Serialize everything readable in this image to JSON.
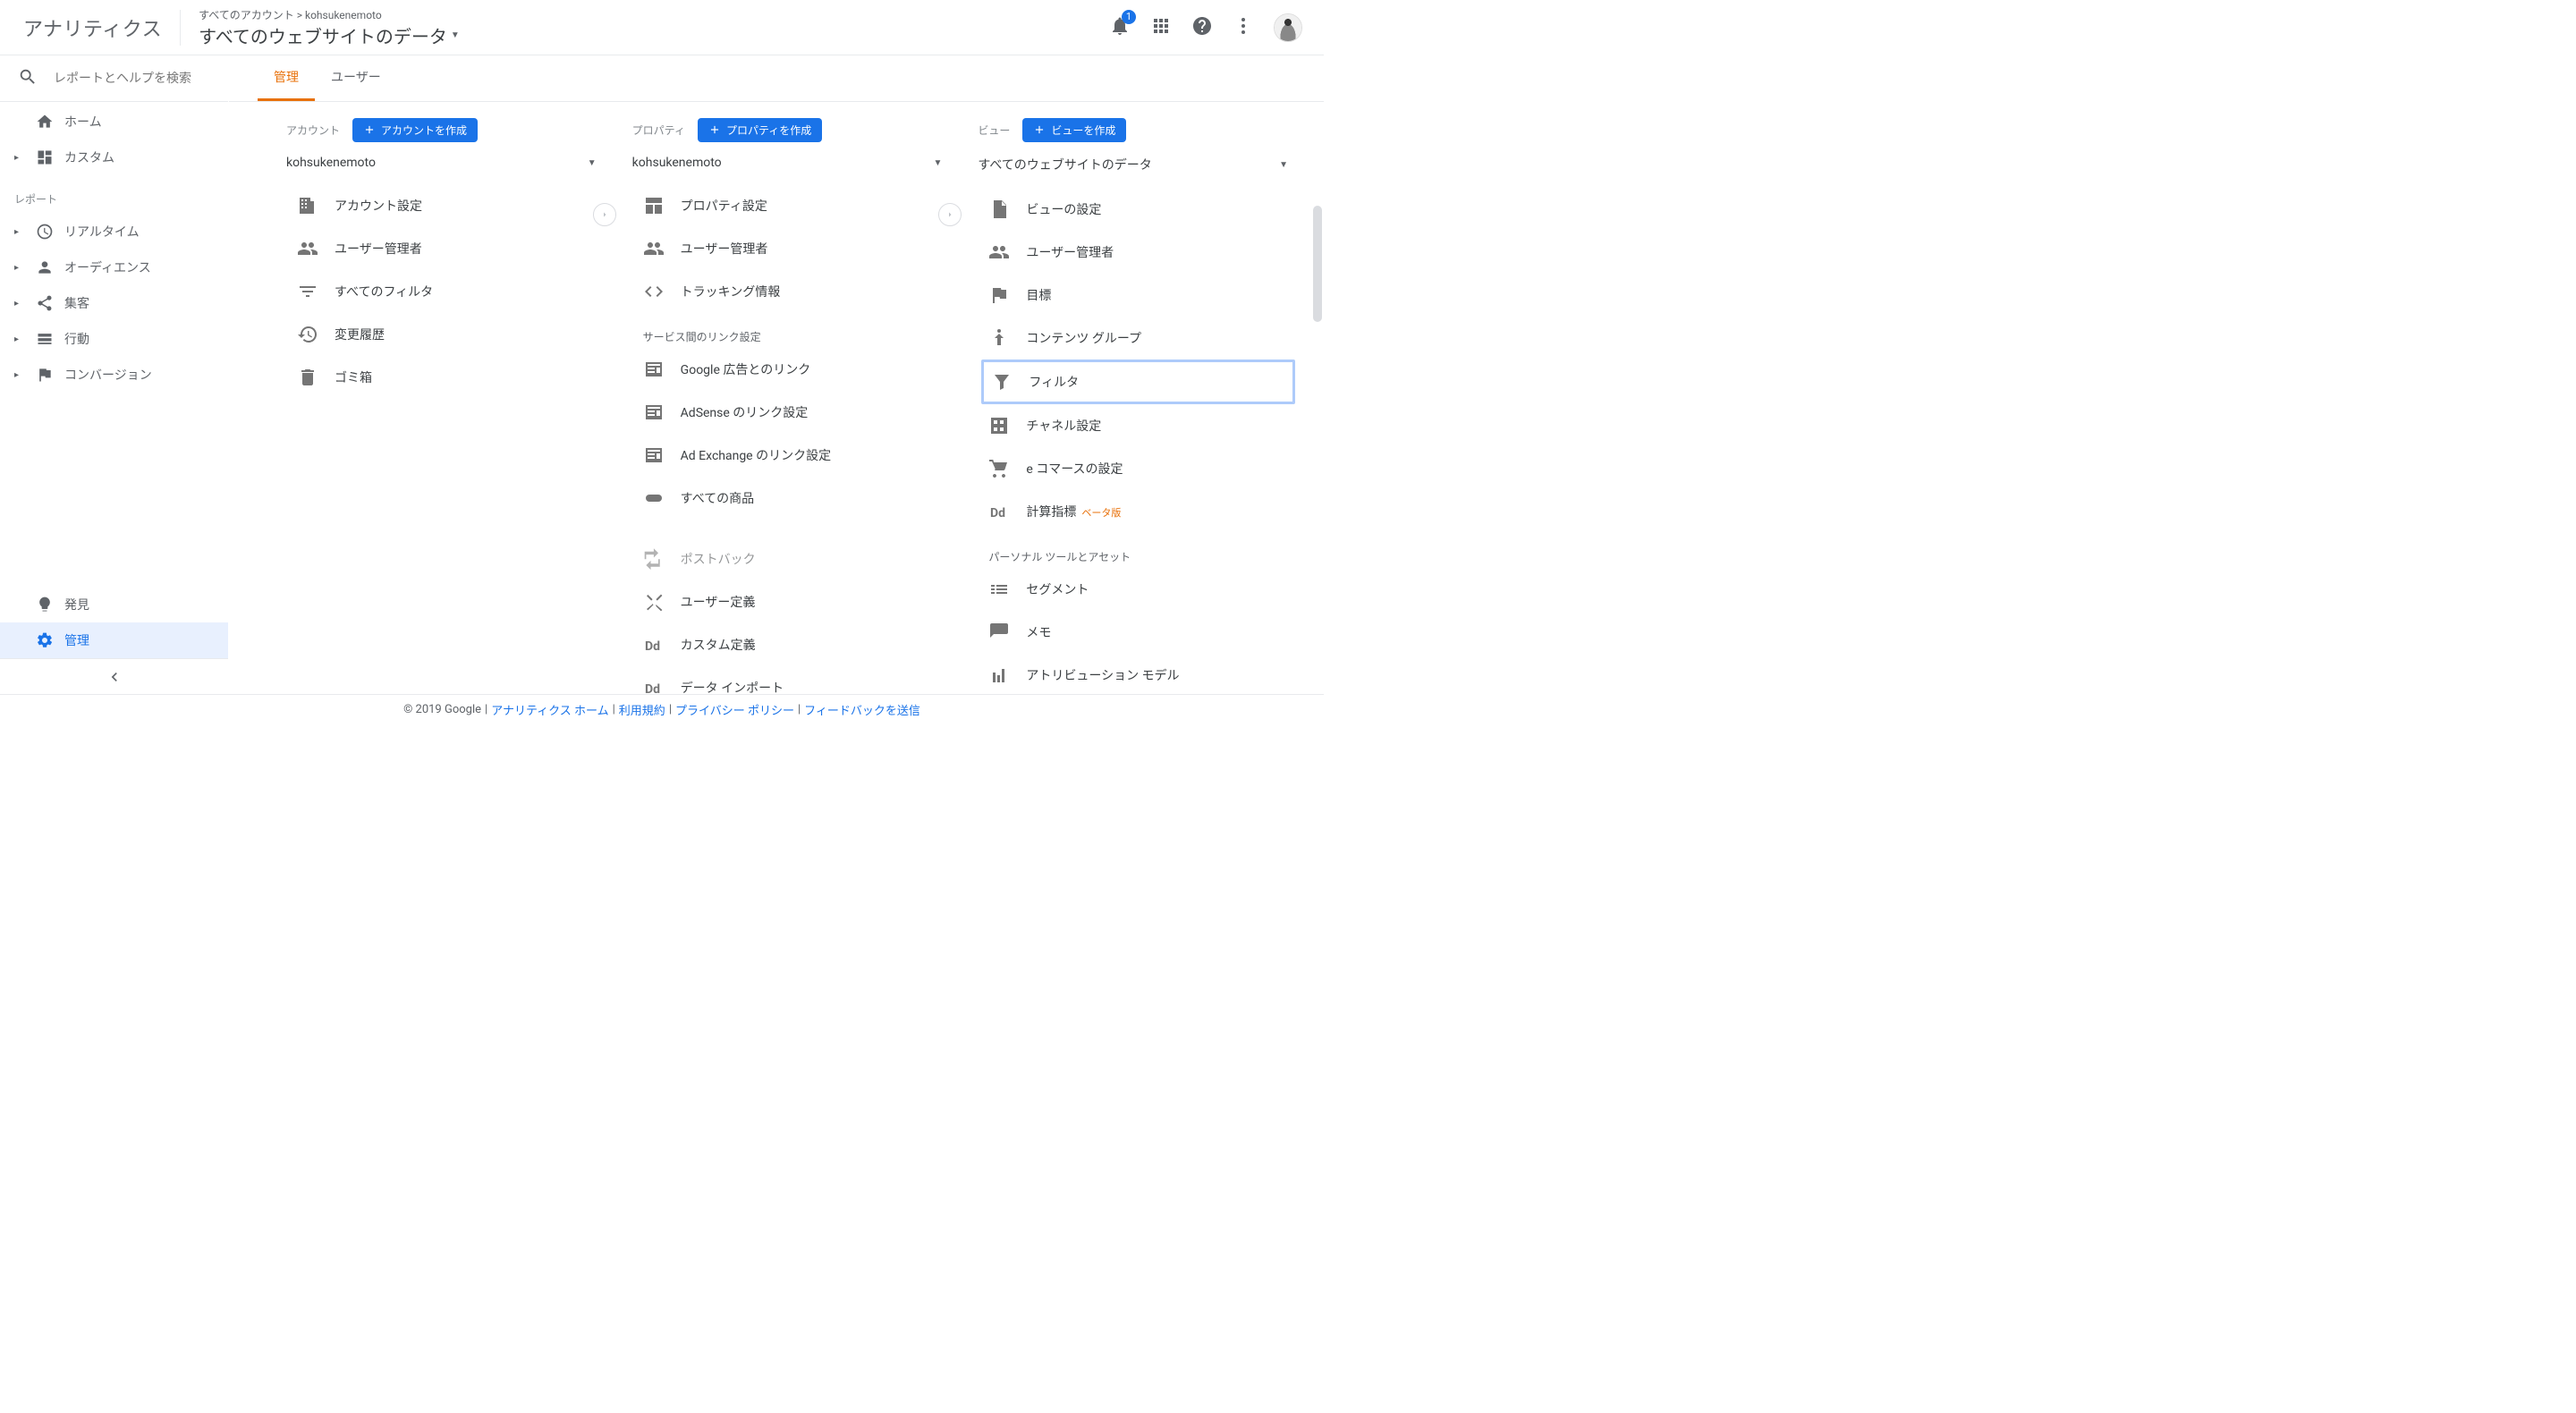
{
  "header": {
    "breadcrumb": "すべてのアカウント > kohsukenemoto",
    "title": "すべてのウェブサイトのデータ",
    "logo_text": "アナリティクス",
    "notification_count": "1"
  },
  "search": {
    "placeholder": "レポートとヘルプを検索"
  },
  "sidebar": {
    "home": "ホーム",
    "custom": "カスタム",
    "reports_label": "レポート",
    "realtime": "リアルタイム",
    "audience": "オーディエンス",
    "acquisition": "集客",
    "behavior": "行動",
    "conversions": "コンバージョン",
    "discover": "発見",
    "admin": "管理"
  },
  "tabs": {
    "admin": "管理",
    "user": "ユーザー"
  },
  "columns": {
    "account": {
      "label": "アカウント",
      "create": "アカウントを作成",
      "selected": "kohsukenemoto",
      "items": [
        "アカウント設定",
        "ユーザー管理者",
        "すべてのフィルタ",
        "変更履歴",
        "ゴミ箱"
      ]
    },
    "property": {
      "label": "プロパティ",
      "create": "プロパティを作成",
      "selected": "kohsukenemoto",
      "items1": [
        "プロパティ設定",
        "ユーザー管理者",
        "トラッキング情報"
      ],
      "sub1": "サービス間のリンク設定",
      "items2": [
        "Google 広告とのリンク",
        "AdSense のリンク設定",
        "Ad Exchange のリンク設定",
        "すべての商品"
      ],
      "items3": [
        "ポストバック",
        "ユーザー定義",
        "カスタム定義",
        "データ インポート"
      ]
    },
    "view": {
      "label": "ビュー",
      "create": "ビューを作成",
      "selected": "すべてのウェブサイトのデータ",
      "items1": [
        "ビューの設定",
        "ユーザー管理者",
        "目標",
        "コンテンツ グループ"
      ],
      "filter": "フィルタ",
      "items2": [
        "チャネル設定",
        "e コマースの設定"
      ],
      "calc_metric": "計算指標",
      "beta": "ベータ版",
      "sub1": "パーソナル ツールとアセット",
      "items3": [
        "セグメント",
        "メモ",
        "アトリビューション モデル"
      ]
    }
  },
  "footer": {
    "copyright": "© 2019 Google",
    "home": "アナリティクス ホーム",
    "terms": "利用規約",
    "privacy": "プライバシー ポリシー",
    "feedback": "フィードバックを送信"
  }
}
